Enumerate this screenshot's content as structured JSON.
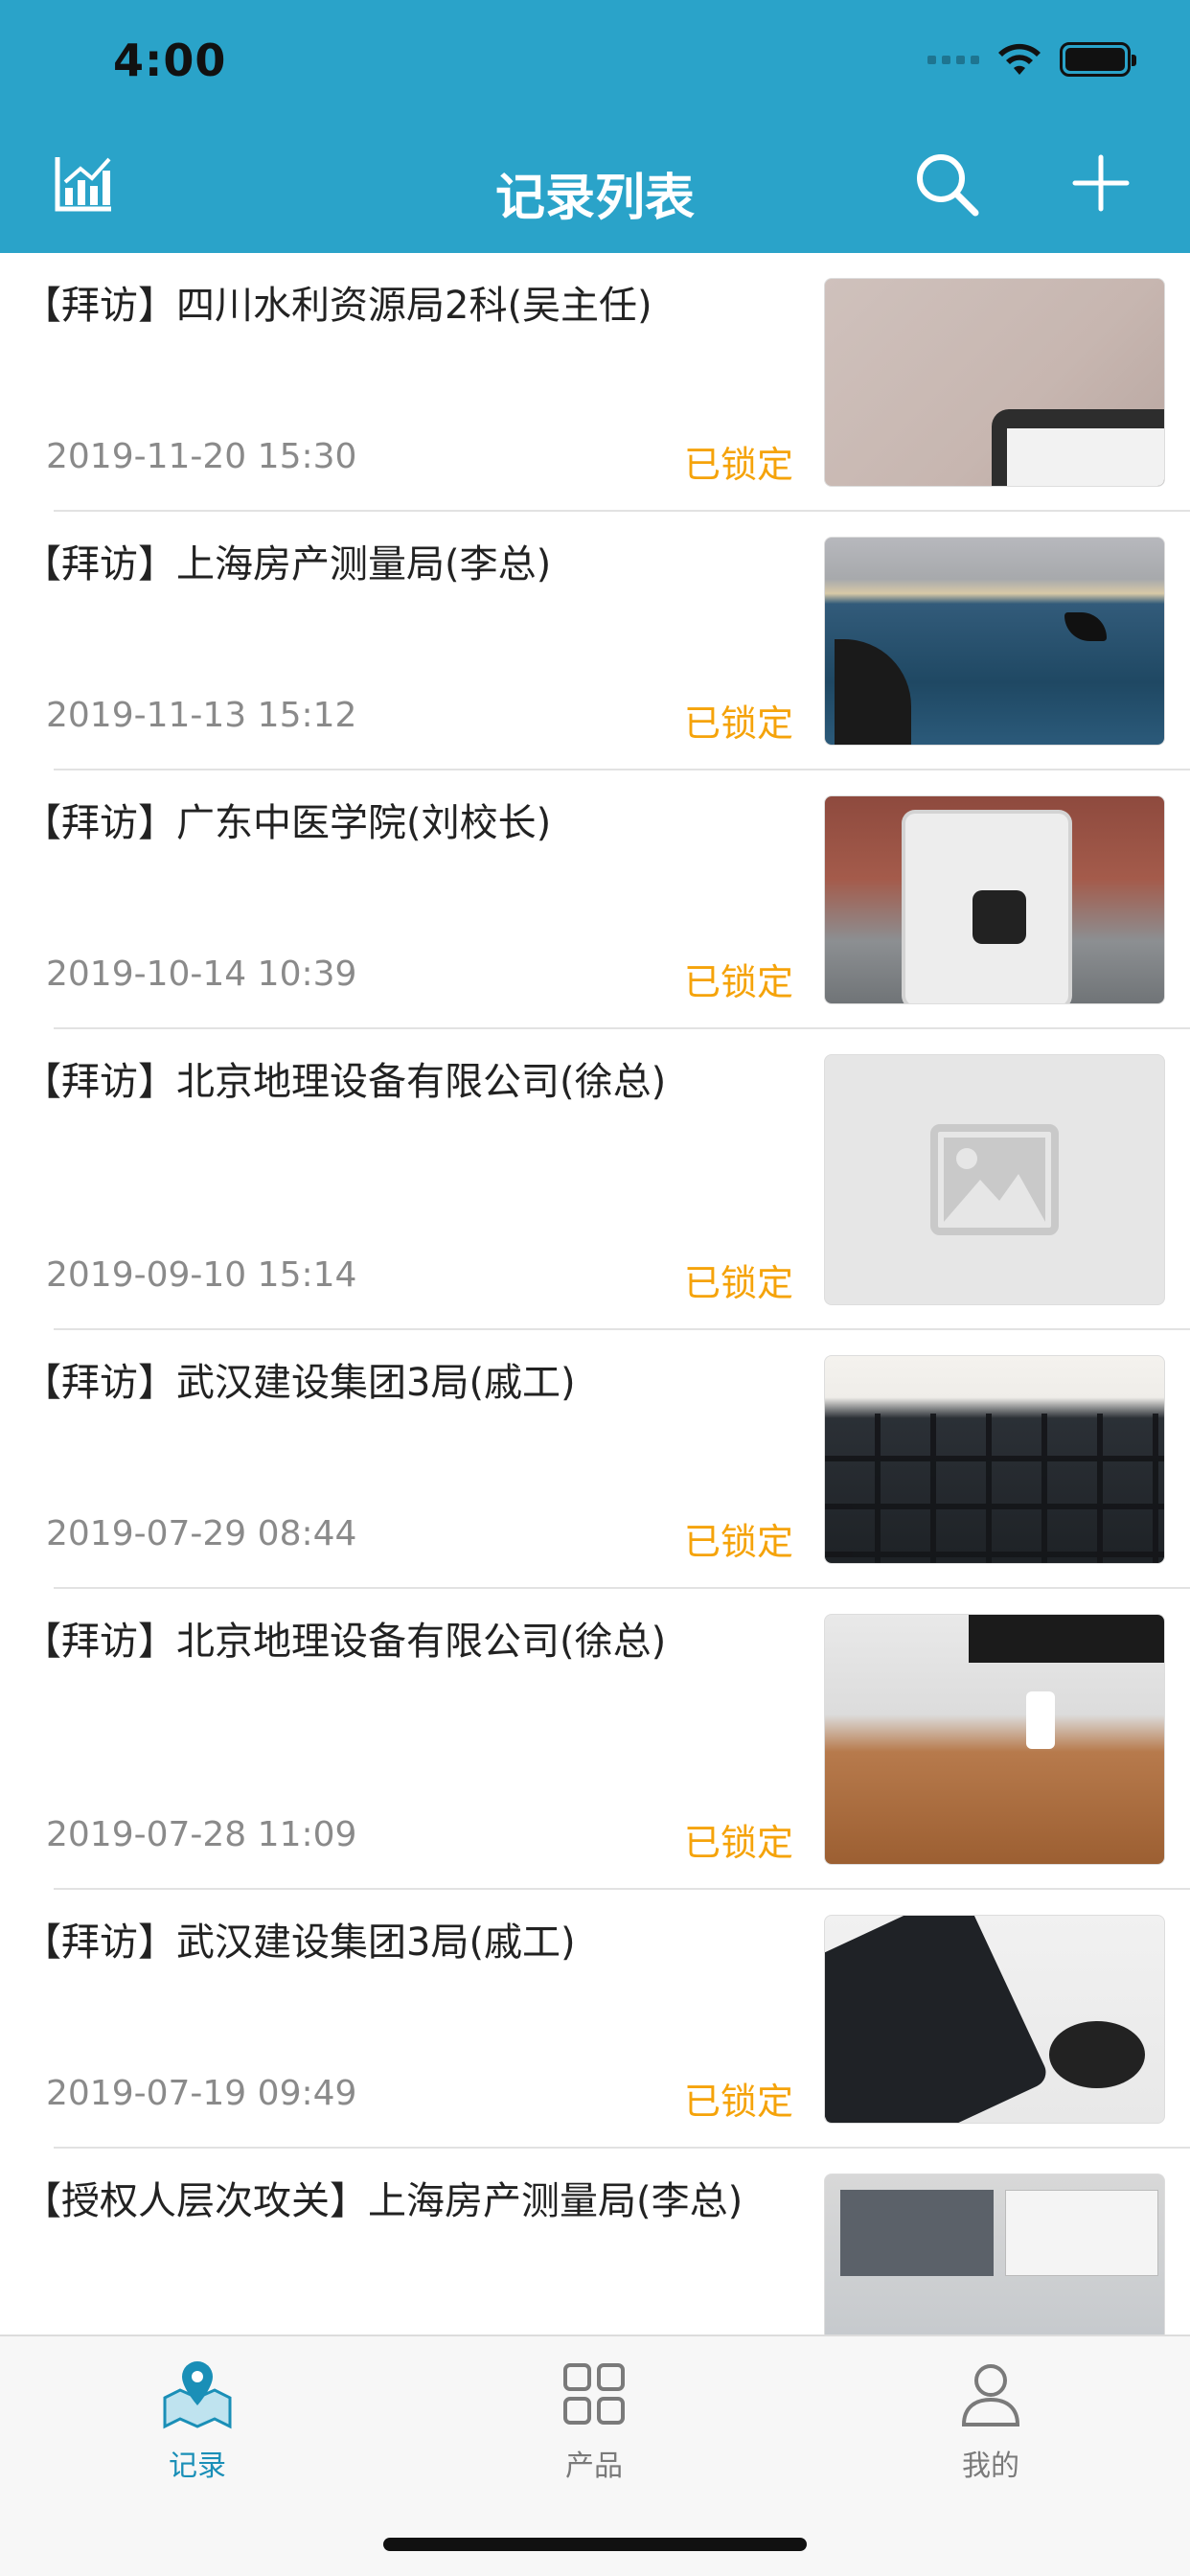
{
  "status_bar": {
    "time": "4:00"
  },
  "nav": {
    "title": "记录列表",
    "left_icon": "chart-icon",
    "search_icon": "search-icon",
    "add_icon": "plus-icon"
  },
  "colors": {
    "header": "#2aa3c9",
    "locked_status": "#f5a30a",
    "tab_active": "#1a8fb7",
    "tab_inactive": "#7a7a7a"
  },
  "records": [
    {
      "title": "【拜访】四川水利资源局2科(吴主任)",
      "time": "2019-11-20 15:30",
      "status": "已锁定"
    },
    {
      "title": "【拜访】上海房产测量局(李总)",
      "time": "2019-11-13 15:12",
      "status": "已锁定"
    },
    {
      "title": "【拜访】广东中医学院(刘校长)",
      "time": "2019-10-14 10:39",
      "status": "已锁定"
    },
    {
      "title": "【拜访】北京地理设备有限公司(徐总)",
      "time": "2019-09-10 15:14",
      "status": "已锁定"
    },
    {
      "title": "【拜访】武汉建设集团3局(戚工)",
      "time": "2019-07-29 08:44",
      "status": "已锁定"
    },
    {
      "title": "【拜访】北京地理设备有限公司(徐总)",
      "time": "2019-07-28 11:09",
      "status": "已锁定"
    },
    {
      "title": "【拜访】武汉建设集团3局(戚工)",
      "time": "2019-07-19 09:49",
      "status": "已锁定"
    },
    {
      "title": "【授权人层次攻关】上海房产测量局(李总)",
      "time": "",
      "status": ""
    }
  ],
  "tabbar": {
    "tabs": [
      {
        "label": "记录",
        "icon": "map-pin-icon",
        "active": true
      },
      {
        "label": "产品",
        "icon": "grid-icon",
        "active": false
      },
      {
        "label": "我的",
        "icon": "person-icon",
        "active": false
      }
    ]
  }
}
